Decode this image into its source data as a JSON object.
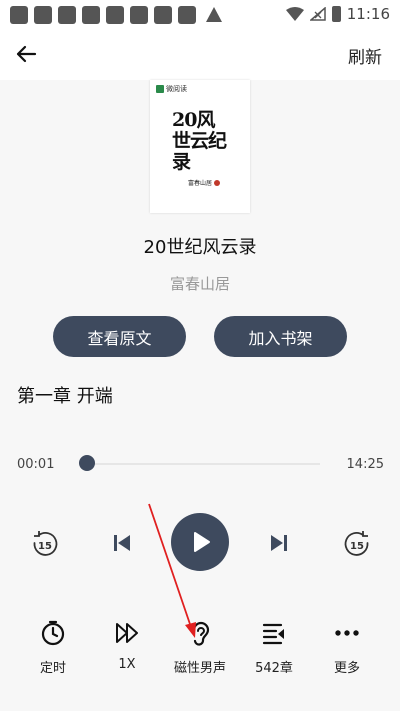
{
  "status_bar": {
    "time": "11:16"
  },
  "header": {
    "refresh_label": "刷新"
  },
  "cover": {
    "publisher": "微阅读",
    "title_text": "20风世云纪录",
    "author_text": "富春山居"
  },
  "book": {
    "title": "20世纪风云录",
    "author": "富春山居"
  },
  "actions": {
    "view_original": "查看原文",
    "add_to_shelf": "加入书架"
  },
  "chapter": {
    "title": "第一章 开端"
  },
  "player": {
    "current_time": "00:01",
    "total_time": "14:25",
    "progress": 0.001,
    "rewind_seconds": "15",
    "forward_seconds": "15"
  },
  "toolbar": {
    "items": [
      {
        "label": "定时",
        "icon": "timer-icon"
      },
      {
        "label": "1X",
        "icon": "speed-icon"
      },
      {
        "label": "磁性男声",
        "icon": "ear-icon"
      },
      {
        "label": "542章",
        "icon": "chapter-list-icon"
      },
      {
        "label": "更多",
        "icon": "more-icon"
      }
    ]
  },
  "colors": {
    "accent": "#3e4a5e",
    "background": "#f7f7f7",
    "annotation": "#e02020"
  }
}
